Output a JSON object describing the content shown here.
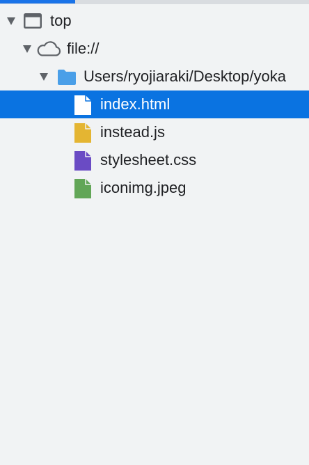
{
  "tree": {
    "frame": {
      "label": "top",
      "icon": "frame-window-icon"
    },
    "origin": {
      "label": "file://",
      "icon": "cloud-icon"
    },
    "folder": {
      "label": "Users/ryojiaraki/Desktop/yoka",
      "icon": "folder-icon"
    },
    "files": [
      {
        "label": "index.html",
        "icon": "html-file-icon",
        "color": "#ffffff",
        "selected": true
      },
      {
        "label": "instead.js",
        "icon": "js-file-icon",
        "color": "#e4b532"
      },
      {
        "label": "stylesheet.css",
        "icon": "css-file-icon",
        "color": "#6a4bc4"
      },
      {
        "label": "iconimg.jpeg",
        "icon": "image-file-icon",
        "color": "#62a657"
      }
    ]
  },
  "colors": {
    "selection": "#0a73e1",
    "folder": "#4a9fe8",
    "accent": "#1a73e8",
    "background": "#f1f3f4"
  }
}
